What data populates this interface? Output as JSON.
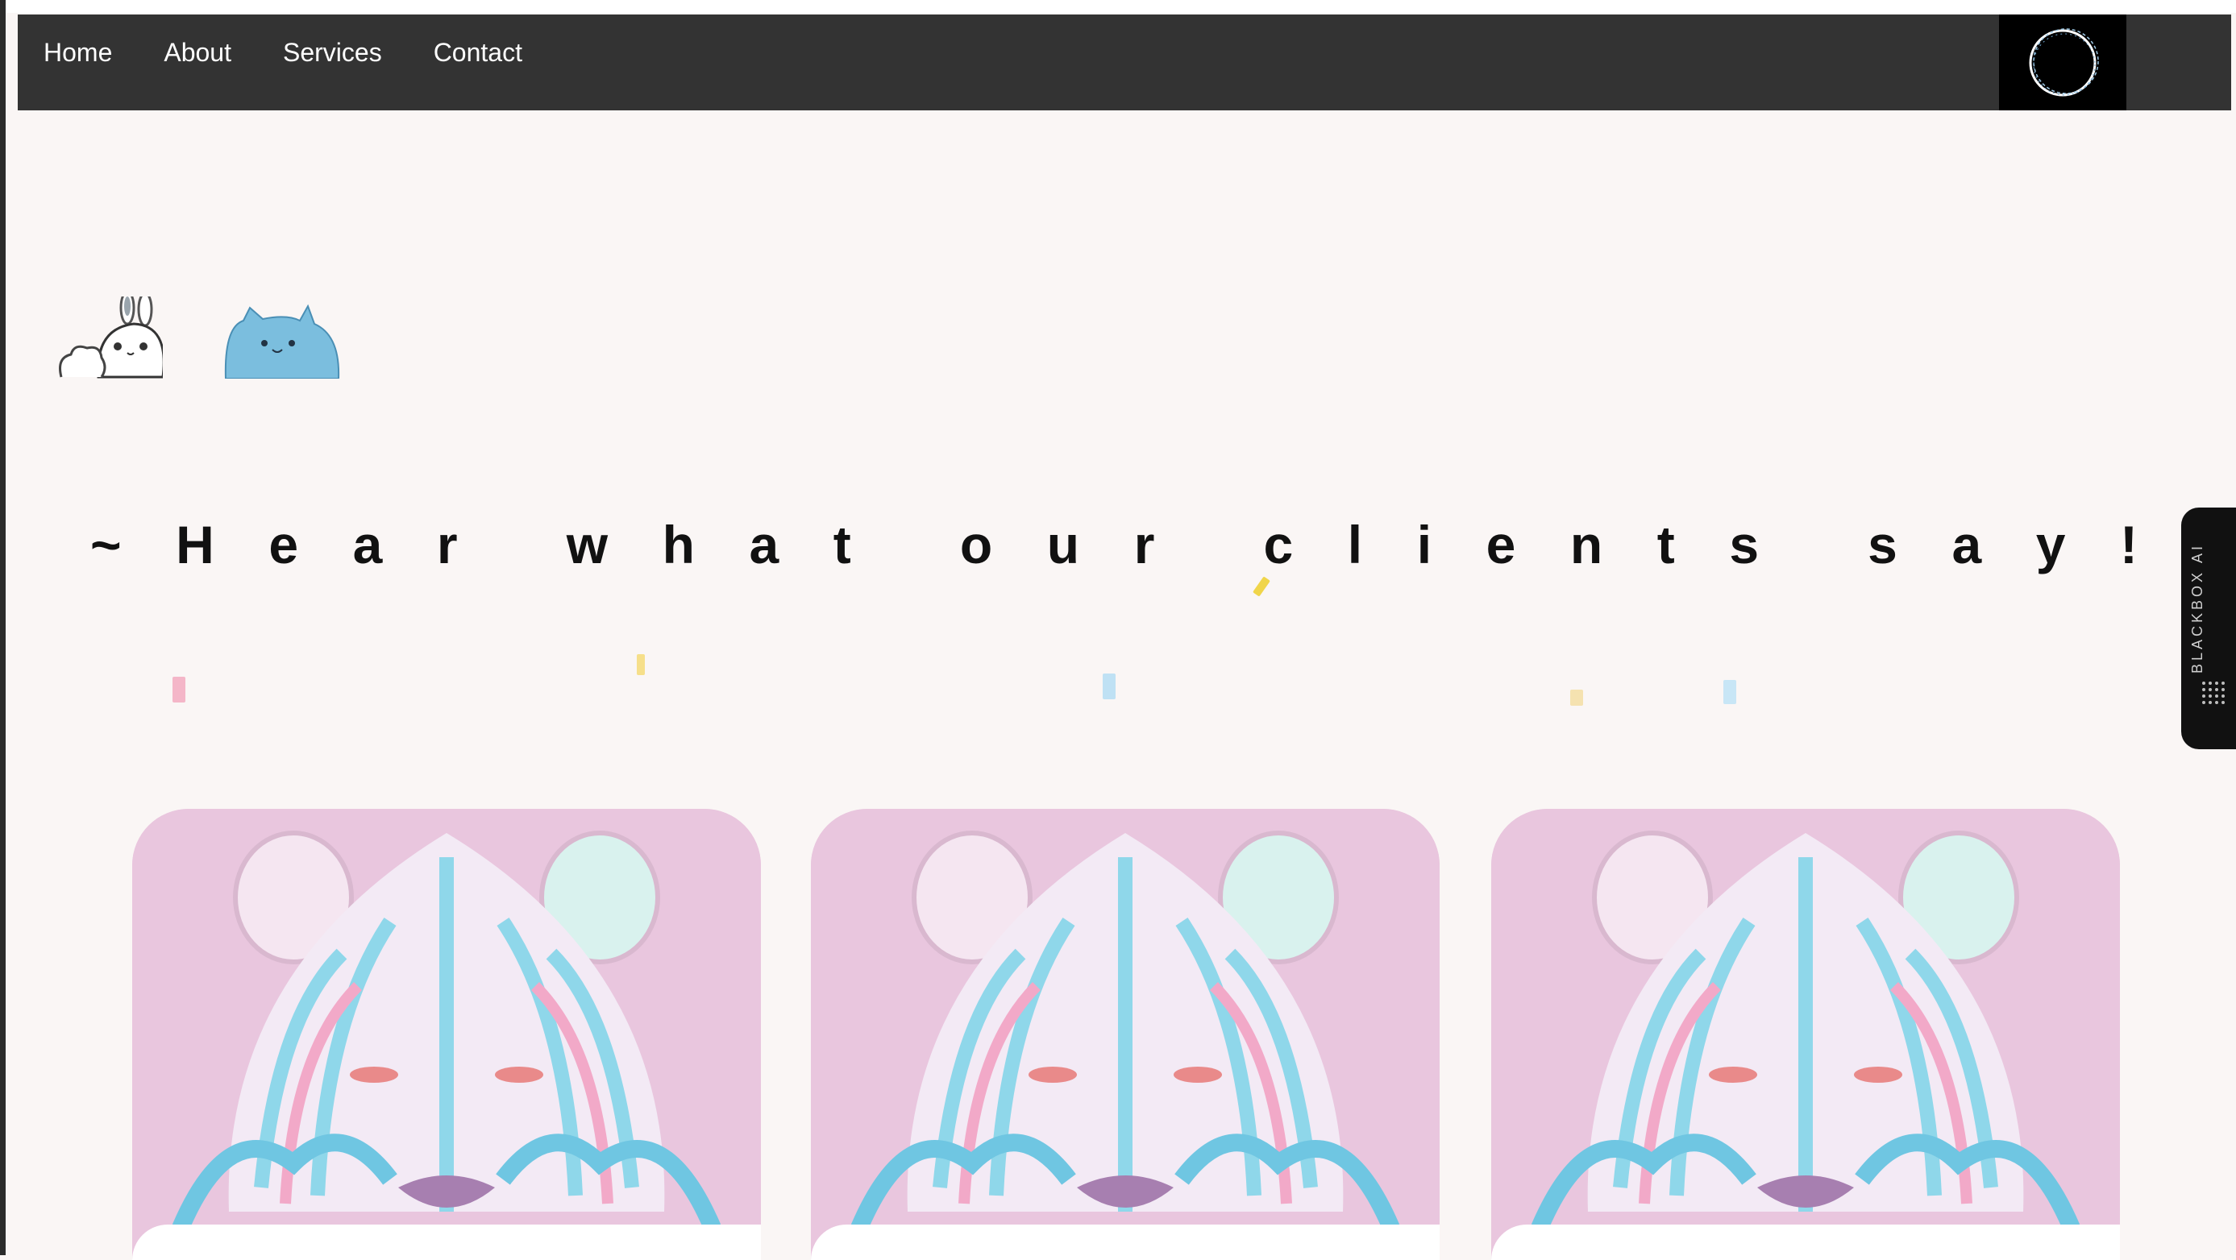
{
  "nav": {
    "links": [
      "Home",
      "About",
      "Services",
      "Contact"
    ]
  },
  "heading": {
    "chars": [
      "~",
      "H",
      "e",
      "a",
      "r",
      "",
      "w",
      "h",
      "a",
      "t",
      "",
      "o",
      "u",
      "r",
      "",
      "c",
      "l",
      "i",
      "e",
      "n",
      "t",
      "s",
      "",
      "s",
      "a",
      "y",
      "!"
    ]
  },
  "side_tab": {
    "label": "BLACKBOX AI"
  },
  "images": {
    "card_image": "pastel-bear-illustration",
    "logo": "circle-logo-icon",
    "mascots": [
      "bunny-mascot",
      "blue-cat-mascot"
    ]
  },
  "colors": {
    "navbar": "#333333",
    "page_bg": "#faf6f5",
    "card_bg": "#e9c6de",
    "confetti": [
      "#f4b6c8",
      "#f6df8a",
      "#bfe1f4",
      "#f5e2b0",
      "#c8e6f6",
      "#f0d54a"
    ]
  }
}
